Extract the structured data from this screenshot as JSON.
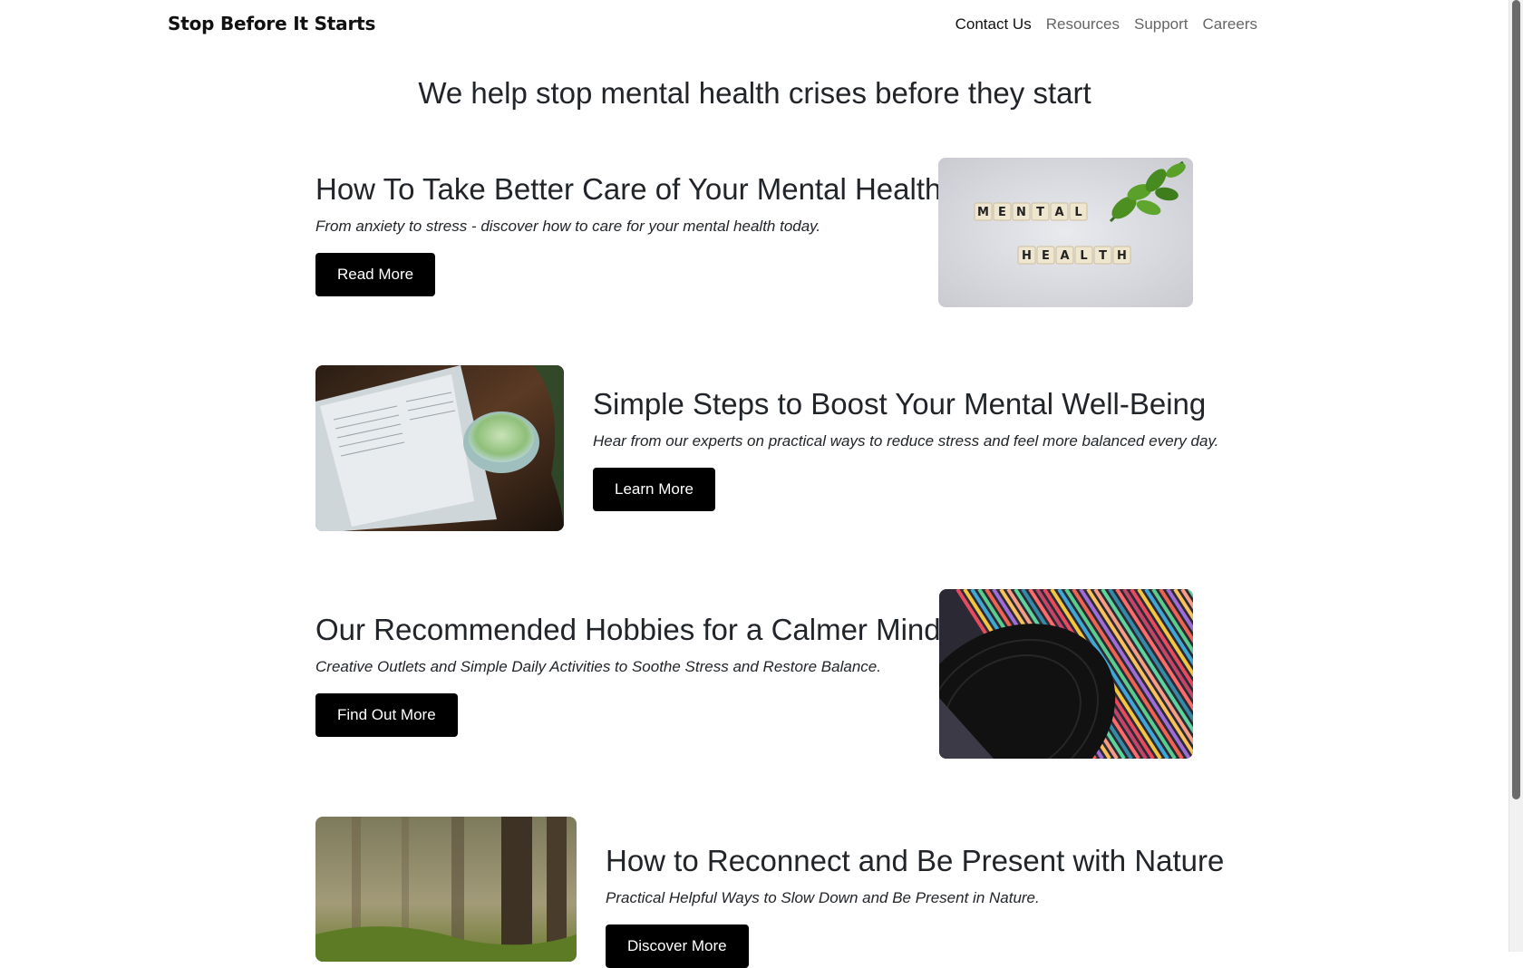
{
  "header": {
    "brand": "Stop Before It Starts",
    "nav": [
      "Contact Us",
      "Resources",
      "Support",
      "Careers"
    ]
  },
  "hero": {
    "title": "We help stop mental health crises before they start"
  },
  "features": [
    {
      "title": "How To Take Better Care of Your Mental Health",
      "subtitle": "From anxiety to stress - discover how to care for your mental health today.",
      "button": "Read More",
      "image_icon": "mental-health-tiles-image",
      "image_text": [
        "MENTAL",
        "HEALTH"
      ]
    },
    {
      "title": "Simple Steps to Boost Your Mental Well-Being",
      "subtitle": "Hear from our experts on practical ways to reduce stress and feel more balanced every day.",
      "button": "Learn More",
      "image_icon": "book-and-tea-image"
    },
    {
      "title": "Our Recommended Hobbies for a Calmer Mind",
      "subtitle": "Creative Outlets and Simple Daily Activities to Soothe Stress and Restore Balance.",
      "button": "Find Out More",
      "image_icon": "vinyl-records-image"
    },
    {
      "title": "How to Reconnect and Be Present with Nature",
      "subtitle": "Practical Helpful Ways to Slow Down and Be Present in Nature.",
      "button": "Discover More",
      "image_icon": "misty-forest-image"
    }
  ],
  "colors": {
    "button_bg": "#000000",
    "button_text": "#ffffff",
    "text": "#212529",
    "nav_muted": "#666666"
  }
}
